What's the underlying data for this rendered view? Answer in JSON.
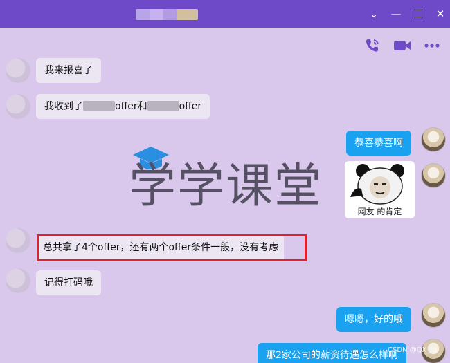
{
  "window": {
    "title_obscured": true,
    "controls": {
      "collapse": "⌄",
      "minimize": "—",
      "close": "✕"
    }
  },
  "toolbar": {
    "icons": [
      "phone-icon",
      "video-icon",
      "more-icon"
    ],
    "accent": "#6e49c8"
  },
  "messages": [
    {
      "side": "in",
      "text": "我来报喜了"
    },
    {
      "side": "in",
      "parts": [
        "我收到了",
        "offer和",
        "offer"
      ]
    },
    {
      "side": "out",
      "text": "恭喜恭喜啊"
    },
    {
      "side": "out",
      "sticker_caption": "网友 的肯定"
    },
    {
      "side": "in",
      "text": "总共拿了4个offer，还有两个offer条件一般，没有考虑",
      "highlighted": true
    },
    {
      "side": "in",
      "text": "记得打码哦"
    },
    {
      "side": "out",
      "text": "嗯嗯，好的哦"
    },
    {
      "side": "out",
      "text": "那2家公司的薪资待遇怎么样啊"
    }
  ],
  "watermark": {
    "text": "学学课堂"
  },
  "footer": {
    "source_mark": "CSDN @QX_Jo"
  },
  "colors": {
    "chat_bg": "#d9c8ec",
    "outgoing_bubble": "#1aa2f0",
    "incoming_bubble": "#ece6f3",
    "highlight": "#e0212b"
  }
}
